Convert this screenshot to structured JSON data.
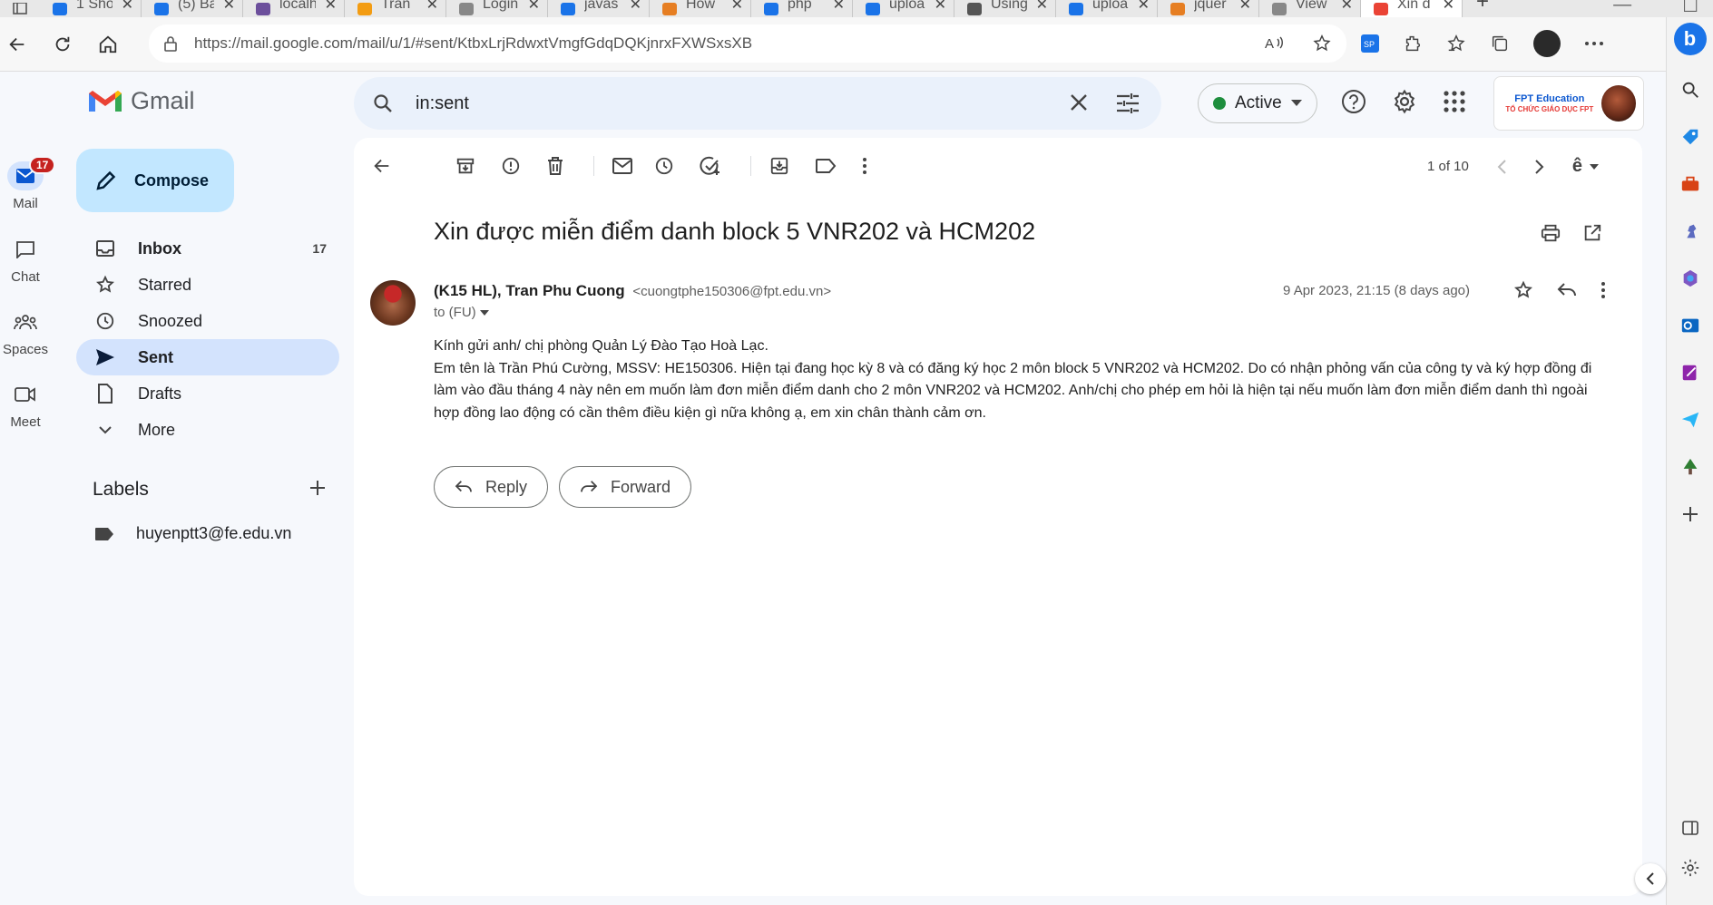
{
  "browser": {
    "tabs": [
      {
        "title": "1 Sho",
        "favicon_color": "#1a73e8"
      },
      {
        "title": "(5) Ba",
        "favicon_color": "#1a73e8"
      },
      {
        "title": "localh",
        "favicon_color": "#6c4f9c"
      },
      {
        "title": "Trần",
        "favicon_color": "#f39c12"
      },
      {
        "title": "Login",
        "favicon_color": "#888888"
      },
      {
        "title": "javas",
        "favicon_color": "#1a73e8"
      },
      {
        "title": "How",
        "favicon_color": "#e67e22"
      },
      {
        "title": "php",
        "favicon_color": "#1a73e8"
      },
      {
        "title": "uploa",
        "favicon_color": "#1a73e8"
      },
      {
        "title": "Using",
        "favicon_color": "#555555"
      },
      {
        "title": "uploa",
        "favicon_color": "#1a73e8"
      },
      {
        "title": "jquer",
        "favicon_color": "#e67e22"
      },
      {
        "title": "View",
        "favicon_color": "#888888"
      },
      {
        "title": "Xin đ",
        "favicon_color": "#ea4335",
        "active": true
      }
    ],
    "url": "https://mail.google.com/mail/u/1/#sent/KtbxLrjRdwxtVmgfGdqDQKjnrxFXWSxsXB"
  },
  "rail": {
    "items": [
      {
        "label": "Mail",
        "badge": "17",
        "active": true
      },
      {
        "label": "Chat"
      },
      {
        "label": "Spaces"
      },
      {
        "label": "Meet"
      }
    ]
  },
  "header": {
    "logo_text": "Gmail",
    "search_query": "in:sent",
    "status": "Active",
    "account_org_top": "FPT Education",
    "account_org_bottom": "TỔ CHỨC GIÁO DỤC FPT"
  },
  "sidebar": {
    "compose_label": "Compose",
    "items": [
      {
        "label": "Inbox",
        "count": "17"
      },
      {
        "label": "Starred"
      },
      {
        "label": "Snoozed"
      },
      {
        "label": "Sent"
      },
      {
        "label": "Drafts"
      },
      {
        "label": "More"
      }
    ],
    "labels_title": "Labels",
    "labels": [
      "huyenptt3@fe.edu.vn"
    ]
  },
  "toolbar": {
    "pager": "1 of 10",
    "input_tool": "ê"
  },
  "message": {
    "subject": "Xin được miễn điểm danh block 5 VNR202 và HCM202",
    "sender_name": "(K15 HL), Tran Phu Cuong",
    "sender_email": "<cuongtphe150306@fpt.edu.vn>",
    "to": "to (FU)",
    "date": "9 Apr 2023, 21:15 (8 days ago)",
    "body_lines": [
      "Kính gửi anh/ chị phòng Quản Lý Đào Tạo Hoà Lạc.",
      "Em tên là Trần Phú Cường, MSSV: HE150306. Hiện tại đang học kỳ 8 và có đăng ký học 2 môn block 5 VNR202 và HCM202. Do có nhận phỏng vấn của công ty và ký hợp đồng đi làm vào đầu tháng 4 này nên em muốn làm đơn miễn điểm danh cho 2 môn VNR202 và HCM202. Anh/chị cho phép em hỏi là hiện tại nếu muốn làm đơn miễn điểm danh thì ngoài hợp đồng lao động có cần thêm điều kiện gì nữa không ạ, em xin chân thành cảm ơn."
    ],
    "reply_label": "Reply",
    "forward_label": "Forward"
  },
  "colors": {
    "accent": "#0b57d0",
    "selected_bg": "#d3e3fd",
    "compose_bg": "#c2e7ff",
    "active_dot": "#1e8e3e",
    "badge": "#c5221f"
  }
}
